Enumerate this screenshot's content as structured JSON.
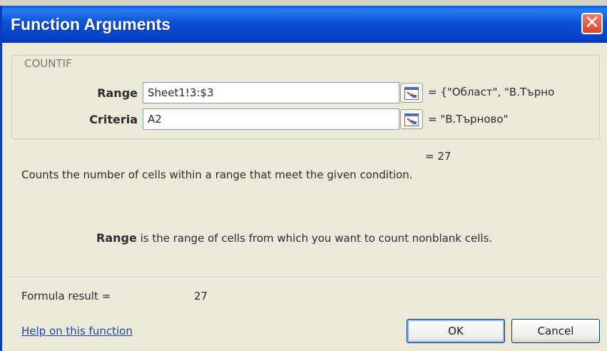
{
  "dialog": {
    "title": "Function Arguments",
    "close_glyph": "✕"
  },
  "function_group": {
    "name": "COUNTIF",
    "args": [
      {
        "label": "Range",
        "value": "Sheet1!3:$3",
        "result": "= {\"Област\", \"В.Търно"
      },
      {
        "label": "Criteria",
        "value": "A2",
        "result": "= \"В.Търново\""
      }
    ]
  },
  "overall_result": "= 27",
  "description": "Counts the number of cells within a range that meet the given condition.",
  "arg_help": {
    "name": "Range",
    "text": "is the range of cells from which you want to count nonblank cells."
  },
  "formula_result": {
    "label": "Formula result =",
    "value": "27"
  },
  "help_link": "Help on this function",
  "buttons": {
    "ok": "OK",
    "cancel": "Cancel"
  },
  "icons": {
    "close": "close-icon",
    "collapse": "collapse-dialog-icon"
  }
}
